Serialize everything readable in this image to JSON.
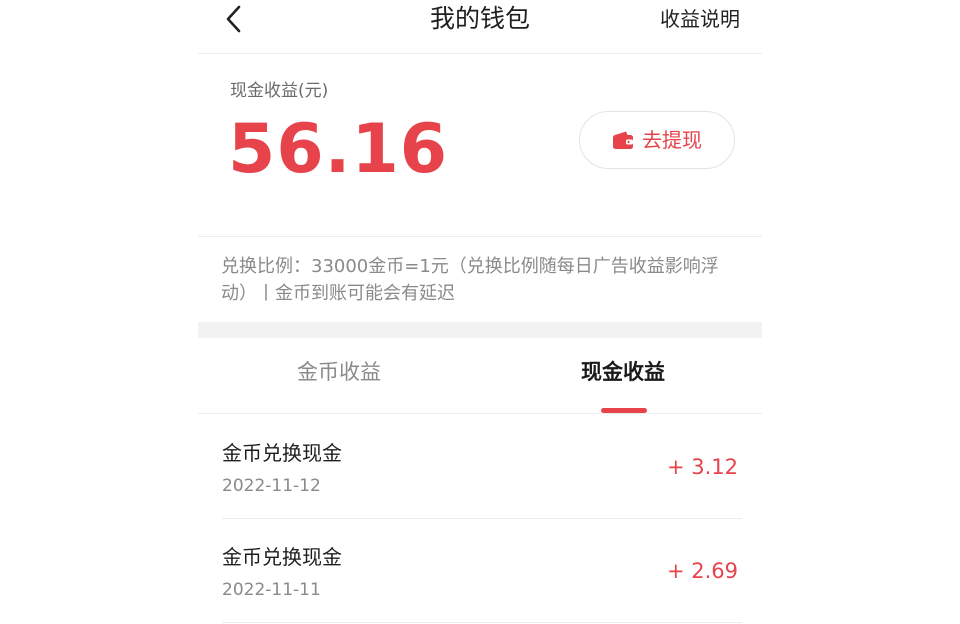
{
  "header": {
    "title": "我的钱包",
    "right_link": "收益说明",
    "back_icon": "chevron-left-icon"
  },
  "balance": {
    "label": "现金收益(元)",
    "amount": "56.16",
    "withdraw_label": "去提现",
    "withdraw_icon": "wallet-icon"
  },
  "exchange_note": "兑换比例：33000金币=1元（兑换比例随每日广告收益影响浮动）丨金币到账可能会有延迟",
  "tabs": [
    {
      "label": "金币收益",
      "active": false
    },
    {
      "label": "现金收益",
      "active": true
    }
  ],
  "records": [
    {
      "title": "金币兑换现金",
      "date": "2022-11-12",
      "amount": "+ 3.12"
    },
    {
      "title": "金币兑换现金",
      "date": "2022-11-11",
      "amount": "+ 2.69"
    }
  ],
  "colors": {
    "accent": "#e6434a",
    "text_primary": "#1f1f1f",
    "text_secondary": "#8a8a8a",
    "divider": "#ececec"
  }
}
